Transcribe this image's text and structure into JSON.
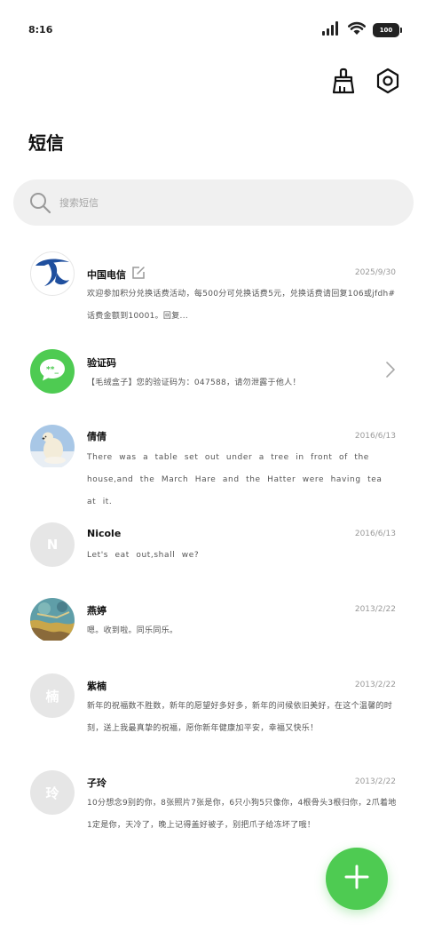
{
  "status_bar": {
    "time": "8:16",
    "battery": "100",
    "icons": [
      "signal-icon",
      "wifi-icon",
      "battery-icon"
    ]
  },
  "toolbar": {
    "icons": [
      "broom-icon",
      "settings-icon"
    ]
  },
  "header": {
    "title": "短信"
  },
  "search": {
    "placeholder": "搜索短信"
  },
  "conversations": [
    {
      "name": "中国电信",
      "date": "2025/9/30",
      "message": "欢迎参加积分兑换话费活动，每500分可兑换话费5元，兑换话费请回复106或jfdh#话费金额到10001。回复...",
      "avatar": "china-telecom-logo"
    },
    {
      "name": "验证码",
      "message": "【毛绒盒子】您的验证码为：047588，请勿泄露于他人！",
      "avatar": "sms-code-icon"
    },
    {
      "name": "倩倩",
      "date": "2016/6/13",
      "message": "There was a table set out under a tree in front of the house,and the March Hare and the Hatter were having tea at it.",
      "avatar": "polar-bear-photo"
    },
    {
      "name": "Nicole",
      "date": "2016/6/13",
      "message": "Let's eat out,shall we?",
      "avatar_letter": "N"
    },
    {
      "name": "燕婷",
      "date": "2013/2/22",
      "message": "嗯。收到啦。同乐同乐。",
      "avatar": "painting-photo"
    },
    {
      "name": "紫楠",
      "date": "2013/2/22",
      "message": "新年的祝福数不胜数，新年的愿望好多好多，新年的问候依旧美好，在这个温馨的时刻，送上我最真挚的祝福，愿你新年健康加平安，幸福又快乐！",
      "avatar_letter": "楠"
    },
    {
      "name": "子玲",
      "date": "2013/2/22",
      "message": "10分想念9别的你，8张照片7张是你，6只小狗5只像你，4根骨头3根归你，2爪着地1定是你，天冷了，晚上记得盖好被子，别把爪子给冻坏了哦！",
      "avatar_letter": "玲"
    }
  ],
  "colors": {
    "accent": "#4ecb52",
    "telecom_blue": "#1f4f9e",
    "search_bg": "#f0f0f0"
  }
}
